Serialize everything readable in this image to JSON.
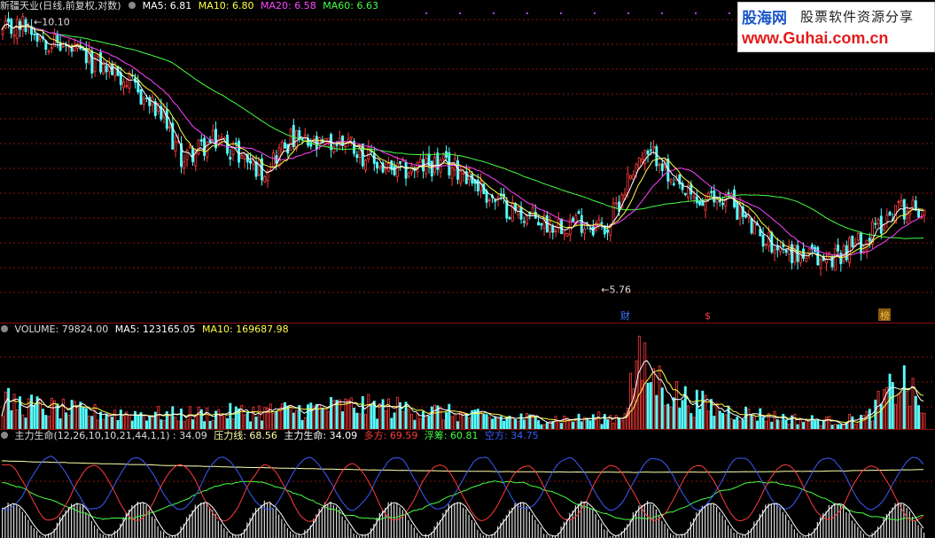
{
  "price_header": {
    "title": "新疆天业(日线,前复权,对数)",
    "ma5": "MA5: 6.81",
    "ma10": "MA10: 6.80",
    "ma20": "MA20: 6.58",
    "ma60": "MA60: 6.63"
  },
  "volume_header": {
    "volume": "VOLUME: 79824.00",
    "ma5": "MA5: 123165.05",
    "ma10": "MA10: 169687.98"
  },
  "indicator_header": {
    "name": "主力生命(12,26,10,10,21,44,1,1) : 34.09",
    "pressure": "压力线: 68.56",
    "life": "主力生命: 34.09",
    "long": "多方: 69.59",
    "float": "浮筹: 60.81",
    "short": "空方: 34.75"
  },
  "logo": {
    "brand": "股海网",
    "slogan": "股票软件资源分享",
    "url": "www.Guhai.com.cn"
  },
  "colors": {
    "up": "#ff3b3b",
    "down": "#54ffff",
    "ma5": "#ffffff",
    "ma10": "#ffff44",
    "ma20": "#ff44ff",
    "ma60": "#44ff44",
    "pressure": "#ffffaa",
    "life": "#ffffff",
    "long": "#ff3b3b",
    "float": "#44ff44",
    "short": "#3b5bff",
    "grid": "#8a1010"
  },
  "chart_data": [
    {
      "type": "candlestick",
      "ylim": [
        5.5,
        10.3
      ],
      "annotations": [
        {
          "label": "10.10",
          "date_index": 8,
          "value": 10.1
        },
        {
          "label": "5.76",
          "date_index": 205,
          "value": 5.76
        }
      ],
      "markers": [
        "财",
        "$",
        "榜"
      ],
      "series_labels": [
        "MA5",
        "MA10",
        "MA20",
        "MA60"
      ],
      "keypoints": [
        [
          0,
          9.85
        ],
        [
          8,
          10.05
        ],
        [
          15,
          9.75
        ],
        [
          30,
          9.3
        ],
        [
          40,
          9.05
        ],
        [
          55,
          8.25
        ],
        [
          62,
          7.55
        ],
        [
          75,
          7.85
        ],
        [
          90,
          7.35
        ],
        [
          100,
          7.85
        ],
        [
          110,
          7.7
        ],
        [
          120,
          7.85
        ],
        [
          125,
          7.6
        ],
        [
          135,
          7.3
        ],
        [
          150,
          7.45
        ],
        [
          160,
          7.35
        ],
        [
          170,
          6.9
        ],
        [
          180,
          6.7
        ],
        [
          190,
          6.55
        ],
        [
          200,
          6.6
        ],
        [
          210,
          6.5
        ],
        [
          220,
          7.5
        ],
        [
          228,
          7.6
        ],
        [
          232,
          7.1
        ],
        [
          242,
          6.85
        ],
        [
          252,
          6.95
        ],
        [
          262,
          6.4
        ],
        [
          275,
          6.15
        ],
        [
          285,
          6.05
        ],
        [
          300,
          6.35
        ],
        [
          310,
          6.8
        ],
        [
          320,
          6.75
        ]
      ]
    },
    {
      "type": "bar",
      "series_labels": [
        "VOLUME",
        "MA5",
        "MA10"
      ],
      "ylim": [
        0,
        420000
      ],
      "volume_keypoints": [
        [
          0,
          130000
        ],
        [
          10,
          110000
        ],
        [
          30,
          80000
        ],
        [
          60,
          70000
        ],
        [
          100,
          90000
        ],
        [
          120,
          110000
        ],
        [
          140,
          100000
        ],
        [
          170,
          55000
        ],
        [
          200,
          50000
        ],
        [
          215,
          60000
        ],
        [
          220,
          300000
        ],
        [
          235,
          150000
        ],
        [
          250,
          90000
        ],
        [
          275,
          50000
        ],
        [
          290,
          40000
        ],
        [
          300,
          60000
        ],
        [
          312,
          230000
        ],
        [
          320,
          80000
        ]
      ]
    },
    {
      "type": "line",
      "ylim": [
        0,
        100
      ],
      "series": [
        {
          "name": "压力线",
          "color_key": "pressure"
        },
        {
          "name": "主力生命",
          "color_key": "life"
        },
        {
          "name": "多方",
          "color_key": "long"
        },
        {
          "name": "浮筹",
          "color_key": "float"
        },
        {
          "name": "空方",
          "color_key": "short"
        }
      ]
    }
  ]
}
